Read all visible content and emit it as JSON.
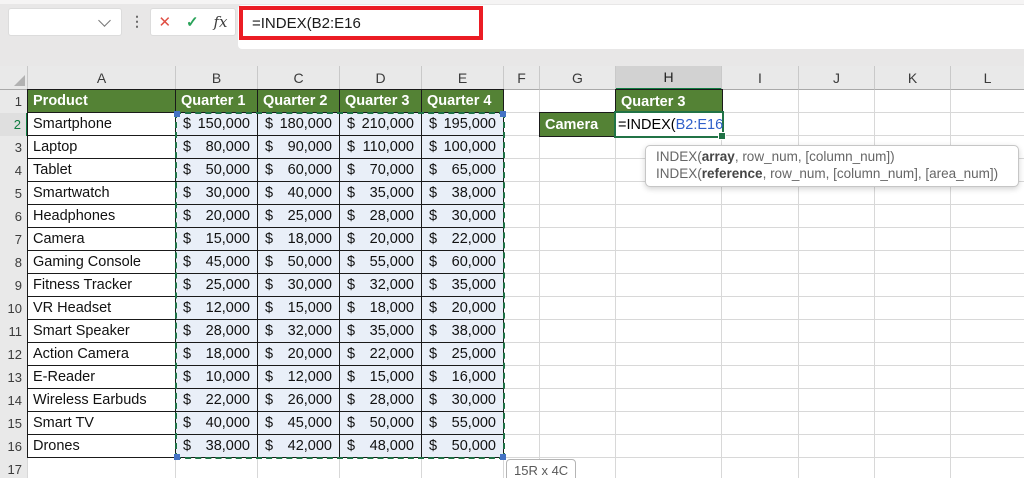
{
  "formula_bar": {
    "name_box_value": "",
    "value": "=INDEX(B2:E16",
    "cancel_icon": "✕",
    "enter_icon": "✓",
    "fx_label": "fx",
    "more_options_icon": "⋮"
  },
  "sheet": {
    "column_headers": [
      "A",
      "B",
      "C",
      "D",
      "E",
      "F",
      "G",
      "H",
      "I",
      "J",
      "K",
      "L"
    ],
    "row_headers": [
      "1",
      "2",
      "3",
      "4",
      "5",
      "6",
      "7",
      "8",
      "9",
      "10",
      "11",
      "12",
      "13",
      "14",
      "15",
      "16",
      "17"
    ],
    "selected_column": "H",
    "selected_row": "2"
  },
  "table": {
    "currency_symbol": "$",
    "header_row": [
      "Product",
      "Quarter 1",
      "Quarter 2",
      "Quarter 3",
      "Quarter 4"
    ],
    "rows": [
      [
        "Smartphone",
        "150,000",
        "180,000",
        "210,000",
        "195,000"
      ],
      [
        "Laptop",
        "80,000",
        "90,000",
        "110,000",
        "100,000"
      ],
      [
        "Tablet",
        "50,000",
        "60,000",
        "70,000",
        "65,000"
      ],
      [
        "Smartwatch",
        "30,000",
        "40,000",
        "35,000",
        "38,000"
      ],
      [
        "Headphones",
        "20,000",
        "25,000",
        "28,000",
        "30,000"
      ],
      [
        "Camera",
        "15,000",
        "18,000",
        "20,000",
        "22,000"
      ],
      [
        "Gaming Console",
        "45,000",
        "50,000",
        "55,000",
        "60,000"
      ],
      [
        "Fitness Tracker",
        "25,000",
        "30,000",
        "32,000",
        "35,000"
      ],
      [
        "VR Headset",
        "12,000",
        "15,000",
        "18,000",
        "20,000"
      ],
      [
        "Smart Speaker",
        "28,000",
        "32,000",
        "35,000",
        "38,000"
      ],
      [
        "Action Camera",
        "18,000",
        "20,000",
        "22,000",
        "25,000"
      ],
      [
        "E-Reader",
        "10,000",
        "12,000",
        "15,000",
        "16,000"
      ],
      [
        "Wireless Earbuds",
        "22,000",
        "26,000",
        "28,000",
        "30,000"
      ],
      [
        "Smart TV",
        "40,000",
        "45,000",
        "50,000",
        "55,000"
      ],
      [
        "Drones",
        "38,000",
        "42,000",
        "48,000",
        "50,000"
      ]
    ]
  },
  "lookup": {
    "criteria_value": "Camera",
    "result_header": "Quarter 3",
    "formula_prefix": "=INDEX(",
    "formula_reference": "B2:E16"
  },
  "tooltips": {
    "function_hint": [
      {
        "pre": "INDEX(",
        "bold": "array",
        "post": ", row_num, [column_num])"
      },
      {
        "pre": "INDEX(",
        "bold": "reference",
        "post": ", row_num, [column_num], [area_num])"
      }
    ],
    "range_size": "15R x 4C"
  },
  "colors": {
    "header_green": "#548235",
    "marquee_green": "#1E7145",
    "selection_green": "#217346",
    "reference_blue": "#2F5FC9",
    "highlight_red": "#EB1C24",
    "range_fill": "#E9EFF8",
    "handle_blue": "#4472C4"
  }
}
